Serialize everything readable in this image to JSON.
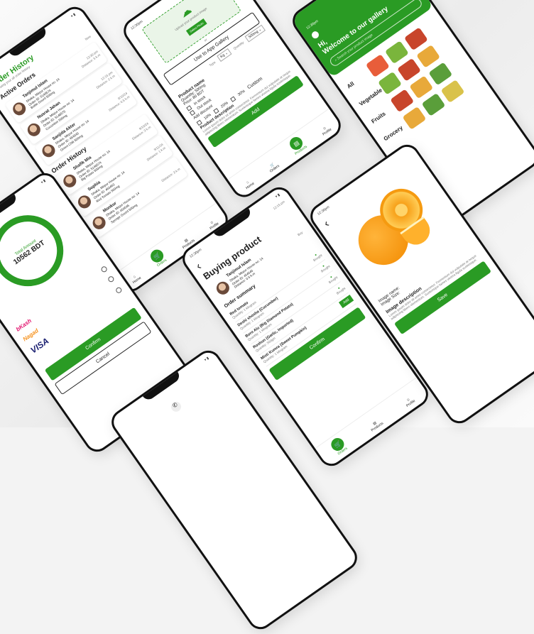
{
  "colors": {
    "accent": "#2a9b24"
  },
  "status_time": "12:30pm",
  "order_history": {
    "title": "Order History",
    "subtitle": "Showing your all order history",
    "active_title": "Active Orders",
    "now": "Now",
    "active": [
      {
        "name": "Tanjimul Islam",
        "addr": "Dhaka, Mirpur House no: 14",
        "id": "Order ID: 5148574",
        "item": "Bottle Gourd 500mg",
        "dist": "Distance: 5 k.m",
        "time": "12:30 pm"
      },
      {
        "name": "Nusrat Jahan",
        "addr": "Dhaka, Mirpur House no: 14",
        "id": "Order ID: 5148575",
        "item": "Cucumber 500mg",
        "dist": "Distance: 2 k.m",
        "time": "12:15 pm"
      },
      {
        "name": "Sanjida Akter",
        "addr": "Dhaka, Mirpur House no: 14",
        "id": "Order ID: 454545",
        "item": "Green Chili 500mg",
        "dist": "Distance: 0.5 k.m",
        "time": "9/10/24"
      }
    ],
    "history_title": "Order History",
    "history": [
      {
        "name": "Shafik Mia",
        "addr": "Dhaka, Mirpur House no: 14",
        "id": "Order ID: 5148574",
        "item": "Big Potato 500mg",
        "dist": "Distance: 3 k.m",
        "time": "9/10/24"
      },
      {
        "name": "Sophia",
        "addr": "Dhaka, Mirpur House no: 14",
        "id": "Order ID: 463463",
        "item": "Red Tomato 500mg",
        "dist": "Distance: 1 k.m",
        "time": "9/11/24"
      },
      {
        "name": "Monkur",
        "addr": "Dhaka, Mirpur House no: 14",
        "id": "Order ID: 454545",
        "item": "Sponge Gourd 500mg",
        "dist": "Distance: 3 k.m",
        "time": ""
      }
    ]
  },
  "nav": {
    "home": "Home",
    "orders": "Orders",
    "products": "Products",
    "profile": "Profile"
  },
  "upload": {
    "prompt": "Upload your product image",
    "browse": "Select Photo",
    "or": "or",
    "gallery": "Use to App Gallery",
    "type_label": "Type",
    "type_value": "Kg",
    "qty_label": "Quantity",
    "qty_value": "500mg",
    "product_name": "Product name",
    "quantity": "Quantity: 500mg",
    "price": "Price: 80 BDT",
    "in_stock": "In stock",
    "out_stock": "Out stock",
    "discount": "Add discount",
    "d1": "10%",
    "d2": "20%",
    "d3": "30%",
    "custom": "Custom",
    "desc_title": "Product description",
    "desc": "Lorem ipsum dolor sit amet consectetur. Fermentum dui vulputate at neque adipiscing libero elementum. Scelerisque fames viverra ligula scelerisque.",
    "add": "Add"
  },
  "gallery": {
    "hi": "Hi,",
    "welcome": "Welcome to our gallery",
    "search_placeholder": "Search your product image",
    "cats": [
      "All",
      "Vegetable",
      "Fruits",
      "Grocery"
    ]
  },
  "payment": {
    "total_label": "Total Amount",
    "total": "10562 BDT",
    "methods": [
      "bKash",
      "Nagad",
      "VISA"
    ],
    "confirm": "Confirm",
    "cancel": "Cancel"
  },
  "buying": {
    "title": "Buying product",
    "time": "12:15 pm",
    "buy": "Buy",
    "customer": {
      "name": "Tanjimul Islam",
      "addr": "Dhaka, Mirpur House no: 14",
      "id": "Order ID: 454545",
      "dist": "Distance: 0.5 k.m"
    },
    "summary": "Order summary",
    "bought": "Bought",
    "add": "Add",
    "items": [
      {
        "name": "Red tomato",
        "qty": "Quantity: 1 kilogram"
      },
      {
        "name": "Deshi shosha (Cucumber)",
        "qty": "Quantity: 1 kilogram"
      },
      {
        "name": "Boro Alu (Big Diamond Potato)",
        "qty": "Quantity: 1 kilogram"
      },
      {
        "name": "Roshun (Garlic, Imported)",
        "qty": "Quantity: 500gm"
      },
      {
        "name": "Misti Kumra (Sweet Pumpkin)",
        "qty": "Quantity: 1 kilogram"
      }
    ],
    "confirm": "Confirm"
  },
  "image_detail": {
    "name_label": "Image name:",
    "size_label": "Image Size:",
    "desc_title": "Image description",
    "desc": "Lorem ipsum dolor sit amet consectetur. Fermentum dui vulputate at neque adipiscing libero elementum. Scelerisque fames viverra ligula scelerisque.",
    "save": "Save"
  }
}
